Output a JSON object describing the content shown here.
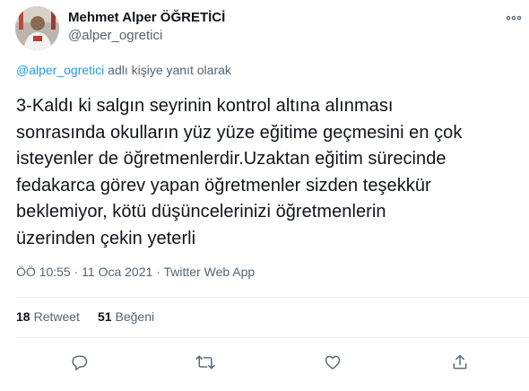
{
  "tweet": {
    "author_name": "Mehmet Alper ÖĞRETİCİ",
    "author_handle": "@alper_ogretici",
    "reply_context": {
      "mention": "@alper_ogretici",
      "suffix": "adlı kişiye yanıt olarak"
    },
    "text": "3-Kaldı ki salgın seyrinin kontrol altına alınması\nsonrasında okulların yüz yüze eğitime geçmesini en çok\nisteyenler de öğretmenlerdir.Uzaktan eğitim sürecinde\nfedakarca görev yapan öğretmenler sizden teşekkür\nbeklemiyor, kötü düşüncelerinizi öğretmenlerin\nüzerinden çekin yeterli",
    "time": "ÖÖ 10:55",
    "separator": "·",
    "date": "11 Oca 2021",
    "source": "Twitter Web App",
    "retweet_count": "18",
    "retweet_label": "Retweet",
    "like_count": "51",
    "like_label": "Beğeni"
  },
  "icons": {
    "more": "more-horizontal-icon",
    "reply": "reply-bubble-icon",
    "retweet": "retweet-arrows-icon",
    "like": "heart-icon",
    "share": "share-upload-icon"
  },
  "colors": {
    "text": "#0f1419",
    "secondary": "#536471",
    "link": "#1d9bf0",
    "divider": "#eff3f4"
  }
}
